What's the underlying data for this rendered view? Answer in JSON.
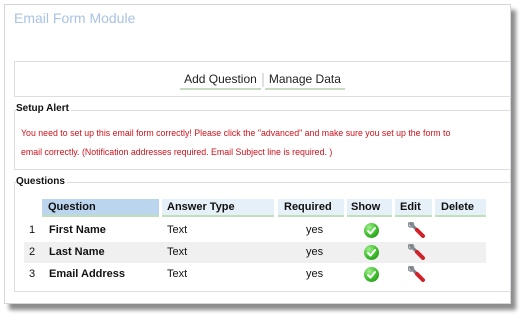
{
  "module": {
    "title": "Email Form Module"
  },
  "nav": {
    "tabs": [
      "Add Question",
      "Manage Data"
    ]
  },
  "setup_alert": {
    "label": "Setup Alert",
    "line1": "You need to set up this email form correctly! Please click the \"advanced\" and make sure you set up the form to",
    "line2": "email correctly. (Notification addresses required. Email Subject line is required. )"
  },
  "questions": {
    "label": "Questions",
    "columns": [
      "Question",
      "Answer Type",
      "Required",
      "Show",
      "Edit",
      "Delete"
    ],
    "rows": [
      {
        "num": "1",
        "question": "First Name",
        "answer_type": "Text",
        "required": "yes",
        "show_icon": "green-check-icon",
        "edit_icon": "wrench-icon"
      },
      {
        "num": "2",
        "question": "Last Name",
        "answer_type": "Text",
        "required": "yes",
        "show_icon": "green-check-icon",
        "edit_icon": "wrench-icon"
      },
      {
        "num": "3",
        "question": "Email Address",
        "answer_type": "Text",
        "required": "yes",
        "show_icon": "green-check-icon",
        "edit_icon": "wrench-icon"
      }
    ]
  },
  "colors": {
    "title": "#a9c3e3",
    "alert": "#d0101a",
    "header_bg": "#e6f0f9",
    "header_active": "#bcd5ee",
    "underline": "#bfe0b8"
  }
}
